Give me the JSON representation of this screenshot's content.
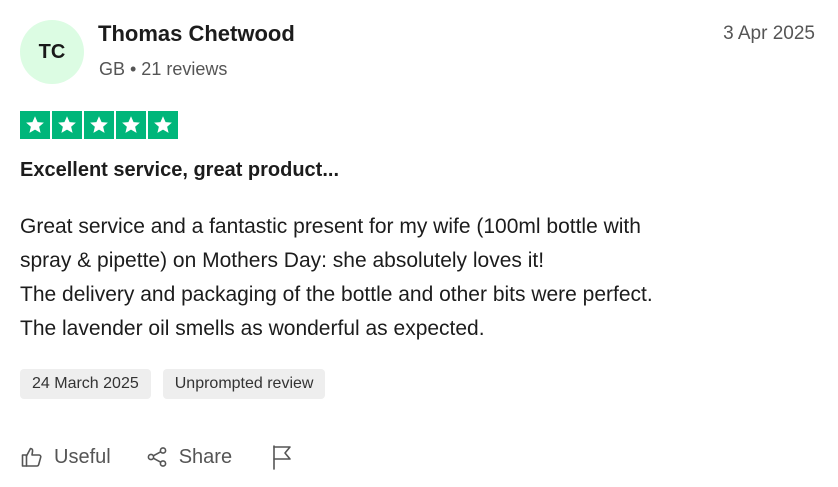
{
  "reviewer": {
    "initials": "TC",
    "name": "Thomas Chetwood",
    "meta": "GB • 21 reviews"
  },
  "review_date": "3 Apr 2025",
  "rating": {
    "stars": 5,
    "max": 5,
    "color": "#00b67a"
  },
  "review": {
    "title": "Excellent service, great product...",
    "body_lines": [
      "Great service and a fantastic present for my wife (100ml bottle with",
      "spray & pipette) on Mothers Day: she absolutely loves it!",
      "The delivery and packaging of the bottle and other bits were perfect.",
      "The lavender oil smells as wonderful as expected."
    ]
  },
  "tags": {
    "experience_date": "24 March 2025",
    "review_type": "Unprompted review"
  },
  "actions": {
    "useful_label": "Useful",
    "share_label": "Share",
    "icons": [
      "thumbs-up-icon",
      "share-icon",
      "flag-icon"
    ]
  }
}
